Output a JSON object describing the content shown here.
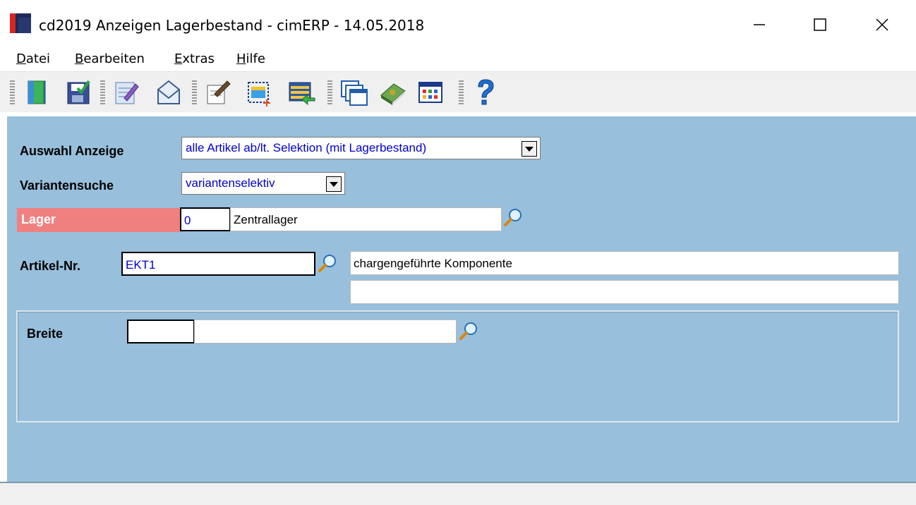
{
  "window": {
    "title": "cd2019 Anzeigen Lagerbestand - cimERP - 14.05.2018",
    "controls": {
      "minimize": "—",
      "maximize": "☐",
      "close": "✕"
    }
  },
  "menu": {
    "items": [
      {
        "underline": "D",
        "rest": "atei"
      },
      {
        "underline": "B",
        "rest": "earbeiten"
      },
      {
        "underline": "E",
        "rest": "xtras"
      },
      {
        "underline": "H",
        "rest": "ilfe"
      }
    ]
  },
  "toolbar": {
    "icons": [
      "exit-door-icon",
      "save-icon",
      "edit-notepad-icon",
      "mail-envelope-icon",
      "notes-icon",
      "new-window-icon",
      "transfer-list-icon",
      "windows-stack-icon",
      "book-icon",
      "table-view-icon",
      "help-icon"
    ]
  },
  "form": {
    "auswahl": {
      "label": "Auswahl Anzeige",
      "value": "alle Artikel ab/lt. Selektion (mit Lagerbestand)"
    },
    "variantensuche": {
      "label": "Variantensuche",
      "value": "variantenselektiv"
    },
    "lager": {
      "label": "Lager",
      "code": "0",
      "name": "Zentrallager"
    },
    "artikel": {
      "label": "Artikel-Nr.",
      "code": "EKT1",
      "description1": "chargengeführte Komponente",
      "description2": ""
    },
    "breite": {
      "label": "Breite",
      "code": "",
      "name": ""
    }
  },
  "colors": {
    "form_background": "#98bfdb",
    "lager_label_background": "#f08080",
    "input_text": "#0000cc"
  }
}
